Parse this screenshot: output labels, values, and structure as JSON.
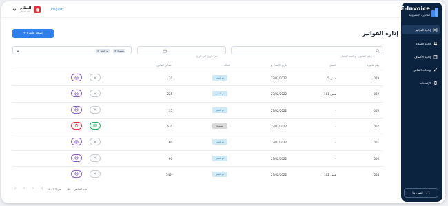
{
  "brand": {
    "title": "E-Invoice",
    "subtitle": "الفاتورة الإلكترونية"
  },
  "sidebar": {
    "items": [
      {
        "label": "إدارة الفواتير",
        "icon": "invoice-icon",
        "active": true
      },
      {
        "label": "إدارة العملاء",
        "icon": "users-icon",
        "active": false
      },
      {
        "label": "إدارة الأصناف",
        "icon": "box-icon",
        "active": false
      },
      {
        "label": "وحدات القياس",
        "icon": "ruler-icon",
        "active": false
      },
      {
        "label": "الإعدادات",
        "icon": "gear-icon",
        "active": false
      }
    ],
    "contact": "اتصل بنا"
  },
  "header": {
    "user_name": "النظام",
    "user_role": "مالك النظام",
    "language": "English"
  },
  "page": {
    "title": "إدارة الفواتير",
    "add_button": "+ إضافة فاتورة"
  },
  "filters": {
    "search_placeholder": "رقم الفاتورة أو اسم العميل...",
    "date_placeholder": "من تاريخ إلى تاريخ",
    "status_chips": [
      "تم النشر",
      "مسودة"
    ],
    "status_chip_close": "×"
  },
  "table": {
    "columns": [
      "رقم فاتورة",
      "العميل",
      "تاريخ الإنشاء",
      "الحالة",
      "اجمالي الفاتورة"
    ],
    "rows": [
      {
        "number": "003",
        "client": "عميل 5",
        "date": "27/02/2022",
        "status": "تم النشر",
        "total": "20",
        "draft": false
      },
      {
        "number": "002",
        "client": "عميل 101",
        "date": "27/02/2022",
        "status": "تم النشر",
        "total": "225",
        "draft": false
      },
      {
        "number": "005",
        "client": "-",
        "date": "27/02/2022",
        "status": "تم النشر",
        "total": "35",
        "draft": false
      },
      {
        "number": "007",
        "client": "-",
        "date": "27/02/2022",
        "status": "مسودة",
        "total": "670",
        "draft": true
      },
      {
        "number": "001",
        "client": "-",
        "date": "27/02/2022",
        "status": "تم النشر",
        "total": "60",
        "draft": false
      },
      {
        "number": "006",
        "client": "-",
        "date": "27/02/2022",
        "status": "تم النشر",
        "total": "60",
        "draft": false
      },
      {
        "number": "004",
        "client": "عميل 102",
        "date": "27/02/2022",
        "status": "تم النشر",
        "total": "345-",
        "draft": false
      }
    ]
  },
  "pagination": {
    "range": "1 - 7 من 7",
    "per_page_label": "عدد العناصر",
    "per_page": "30"
  },
  "colors": {
    "sidebar": "#0c2340",
    "accent": "#2f80ed",
    "published": "#cfe9f7",
    "draft": "#d9d9d9",
    "delete": "#e0313b",
    "post": "#27ae60",
    "print": "#8e5cc7"
  }
}
